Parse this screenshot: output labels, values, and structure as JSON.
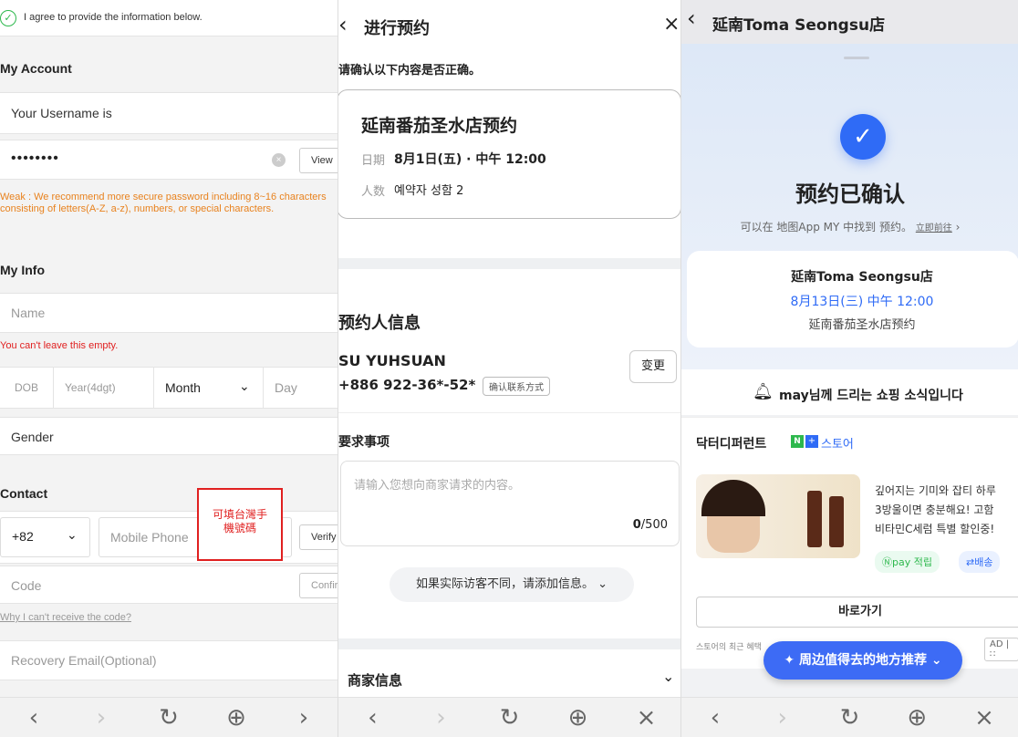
{
  "p1": {
    "agree_text": "I agree to provide the information below.",
    "my_account": "My Account",
    "username_label": "Your Username is",
    "password_value": "••••••••",
    "view_button": "View",
    "password_warning": "Weak : We recommend more secure password including 8~16 characters consisting of letters(A-Z, a-z), numbers, or special characters.",
    "my_info": "My Info",
    "name_placeholder": "Name",
    "name_error": "You can't leave this empty.",
    "dob_label": "DOB",
    "year_placeholder": "Year(4dgt)",
    "month_label": "Month",
    "day_placeholder": "Day",
    "gender_label": "Gender",
    "contact": "Contact",
    "country_code": "+82",
    "mobile_placeholder": "Mobile Phone",
    "verify_button": "Verify",
    "annotation_line1": "可填台灣手",
    "annotation_line2": "機號碼",
    "code_placeholder": "Code",
    "confirm_button": "Confirm",
    "cant_receive": "Why I can't receive the code?",
    "recovery_placeholder": "Recovery Email(Optional)"
  },
  "p2": {
    "title": "进行预约",
    "confirm_prompt": "请确认以下内容是否正确。",
    "store_title": "延南番茄圣水店预约",
    "date_label": "日期",
    "date_value": "8月1日(五) · 中午 12:00",
    "people_label": "人数",
    "people_value": "예약자 성함 2",
    "booker_info": "预约人信息",
    "booker_name": "SU YUHSUAN",
    "booker_phone": "+886 922-36*-52*",
    "confirm_contact": "确认联系方式",
    "change_button": "变更",
    "requests": "要求事项",
    "request_placeholder": "请输入您想向商家请求的内容。",
    "counter_current": "0",
    "counter_max": "/500",
    "add_visitor": "如果实际访客不同，请添加信息。",
    "merchant_info": "商家信息"
  },
  "p3": {
    "title": "延南Toma Seongsu店",
    "confirmed": "预约已确认",
    "hint_prefix": "可以在 地图App MY 中找到 预约。",
    "hint_link": "立即前往",
    "store_name": "延南Toma Seongsu店",
    "datetime": "8月13日(三) 中午 12:00",
    "store_sub": "延南番茄圣水店预约",
    "shopping_news": "may님께 드리는 쇼핑 소식입니다",
    "brand": "닥터디퍼런트",
    "brand_store": "스토어",
    "ad_line1": "깊어지는 기미와 잡티 하루",
    "ad_line2": "3방울이면 충분해요! 고함",
    "ad_line3": "비타민C세럼 특별 할인중!",
    "npay": "pay 적립",
    "delivery": "배송",
    "go_button": "바로가기",
    "footnote": "스토어의 최근 혜택",
    "ad_tag": "AD | ∷",
    "recommend": "周边值得去的地方推荐"
  },
  "colors": {
    "accent_blue": "#2f6bf6",
    "warning_orange": "#e8821e",
    "error_red": "#e02020",
    "green": "#2db84d"
  }
}
